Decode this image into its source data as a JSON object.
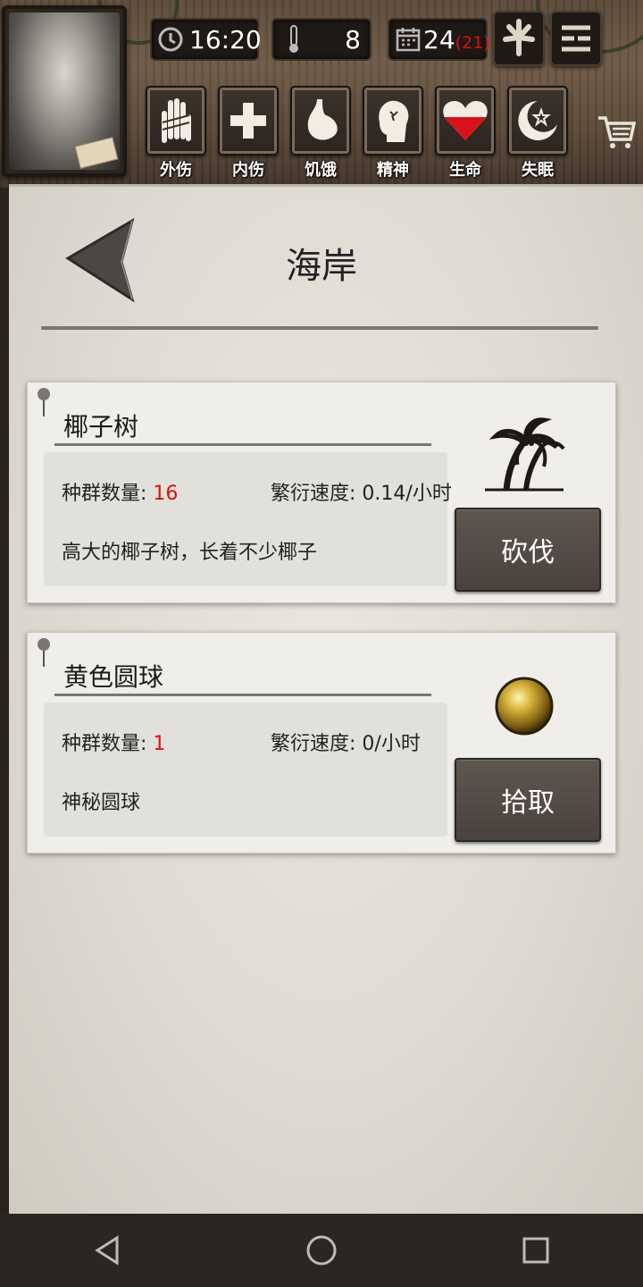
{
  "header": {
    "time": "16:20",
    "temperature": "8",
    "day": "24",
    "day_extra": "(21)",
    "status_items": [
      {
        "label": "外伤",
        "icon": "bandaged-hand-icon"
      },
      {
        "label": "内伤",
        "icon": "plus-icon"
      },
      {
        "label": "饥饿",
        "icon": "stomach-icon"
      },
      {
        "label": "精神",
        "icon": "head-icon"
      },
      {
        "label": "生命",
        "icon": "heart-icon",
        "fill_fraction": 0.5
      },
      {
        "label": "失眠",
        "icon": "moon-icon"
      }
    ]
  },
  "page": {
    "title": "海岸"
  },
  "cards": [
    {
      "name": "椰子树",
      "population_label": "种群数量:",
      "population_value": "16",
      "rate_label": "繁衍速度:",
      "rate_value": "0.14/小时",
      "description": "高大的椰子树，长着不少椰子",
      "action": "砍伐",
      "icon": "palm-tree-icon"
    },
    {
      "name": "黄色圆球",
      "population_label": "种群数量:",
      "population_value": "1",
      "rate_label": "繁衍速度:",
      "rate_value": "0/小时",
      "description": "神秘圆球",
      "action": "拾取",
      "icon": "yellow-orb-icon"
    }
  ],
  "colors": {
    "accent_red": "#dd1111",
    "button_dark": "#4f4743",
    "paper": "#e6e3dc"
  }
}
